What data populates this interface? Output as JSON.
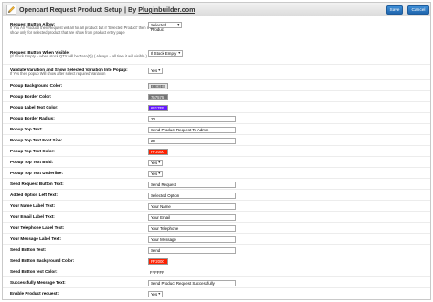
{
  "header": {
    "title": "Opencart Request Product Setup | By ",
    "link": "Pluginbuilder.com",
    "save_label": "Save",
    "cancel_label": "Cancel"
  },
  "rows": {
    "allow": {
      "label": "Request Button Allow:",
      "help": "If You All ProductI then Request will all for all product but if 'Selected Product' then it will show only for selected product that are show from product entry page",
      "value": "Selected Product"
    },
    "when_visible": {
      "label": "Request Button When Visible:",
      "help": "(If Stock Empty = when stock QTY will be Zero(0)) ( Always = all time it will visible )",
      "value": "If Stock Empty"
    },
    "validate": {
      "label": "Validate Variation and Show Selected Variation Into Popup:",
      "help": "If Yes then popup Will show after select required Variation",
      "value": "Yes"
    },
    "popup_bg": {
      "label": "Popup Background Color:",
      "value": "E8E8E8",
      "color": "#E8E8E8",
      "text_color": "#000000"
    },
    "popup_border": {
      "label": "Popup Border Color:",
      "value": "757575",
      "color": "#757575",
      "text_color": "#ffffff"
    },
    "popup_label_text": {
      "label": "Popup Label Text Color:",
      "value": "6417FF",
      "color": "#6417FF",
      "text_color": "#ffffff"
    },
    "popup_border_radius": {
      "label": "Popup Border Radius:",
      "value": "20"
    },
    "popup_top_text": {
      "label": "Popup Top Text:",
      "value": "Send Product Request To Admin"
    },
    "popup_top_font": {
      "label": "Popup Top Text Font Size:",
      "value": "20"
    },
    "popup_top_color": {
      "label": "Popup Top Text Color:",
      "value": "FF2000",
      "color": "#FF2000",
      "text_color": "#ffffff"
    },
    "popup_top_bold": {
      "label": "Popup Top Text Bold:",
      "value": "Yes"
    },
    "popup_top_underline": {
      "label": "Popup Top Text Underline:",
      "value": "Yes"
    },
    "send_button_text": {
      "label": "Send Request Button Text:",
      "value": "Send Request"
    },
    "added_option_left": {
      "label": "Added Option Left Text:",
      "value": "Selected Option"
    },
    "your_name": {
      "label": "Your Name Label Text:",
      "value": "Your Name"
    },
    "your_email": {
      "label": "Your Email Label Text:",
      "value": "Your Email"
    },
    "your_phone": {
      "label": "Your Telephone Label Text:",
      "value": "Your Telephone"
    },
    "your_message": {
      "label": "Your Message Label Text:",
      "value": "Your Message"
    },
    "send_text": {
      "label": "Send Button Text:",
      "value": "Send"
    },
    "send_bg": {
      "label": "Send Button Background Color:",
      "value": "FF2000",
      "color": "#FF2000",
      "text_color": "#ffffff"
    },
    "send_text_color": {
      "label": "Send Button text Color:",
      "value": "FFFFFF"
    },
    "success_msg": {
      "label": "Successfully Message Text:",
      "value": "Send Product Request Successfully"
    },
    "enable": {
      "label": "Enable Product request :",
      "value": "Yes"
    }
  }
}
